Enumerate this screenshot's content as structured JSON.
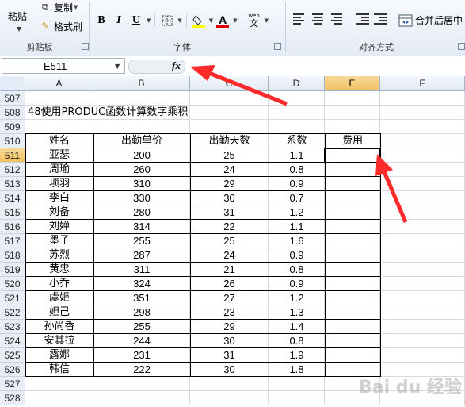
{
  "ribbon": {
    "paste_label": "粘贴",
    "copy_label": "复制",
    "format_painter_label": "格式刷",
    "clipboard_group": "剪贴板",
    "font_group": "字体",
    "align_group": "对齐方式",
    "bold": "B",
    "italic": "I",
    "underline": "U",
    "font_color_letter": "A",
    "merge_label": "合并后居中",
    "wen_label": "wén",
    "wen_char": "文"
  },
  "formula_bar": {
    "name_box": "E511",
    "fx": "fx",
    "formula": ""
  },
  "columns": [
    "A",
    "B",
    "C",
    "D",
    "E",
    "F"
  ],
  "rows": [
    "507",
    "508",
    "509",
    "510",
    "511",
    "512",
    "513",
    "514",
    "515",
    "516",
    "517",
    "518",
    "519",
    "520",
    "521",
    "522",
    "523",
    "524",
    "525",
    "526",
    "527",
    "528"
  ],
  "title": "48使用PRODUC函数计算数字乘积",
  "table": {
    "headers": [
      "姓名",
      "出勤单价",
      "出勤天数",
      "系数",
      "费用"
    ],
    "records": [
      [
        "亚瑟",
        "200",
        "25",
        "1.1",
        ""
      ],
      [
        "周瑜",
        "260",
        "24",
        "0.8",
        ""
      ],
      [
        "项羽",
        "310",
        "29",
        "0.9",
        ""
      ],
      [
        "李白",
        "330",
        "30",
        "0.7",
        ""
      ],
      [
        "刘备",
        "280",
        "31",
        "1.2",
        ""
      ],
      [
        "刘婵",
        "314",
        "22",
        "1.1",
        ""
      ],
      [
        "墨子",
        "255",
        "25",
        "1.6",
        ""
      ],
      [
        "苏烈",
        "287",
        "24",
        "0.9",
        ""
      ],
      [
        "黄忠",
        "311",
        "21",
        "0.8",
        ""
      ],
      [
        "小乔",
        "324",
        "26",
        "0.9",
        ""
      ],
      [
        "虞姬",
        "351",
        "27",
        "1.2",
        ""
      ],
      [
        "妲己",
        "298",
        "23",
        "1.3",
        ""
      ],
      [
        "孙尚香",
        "255",
        "29",
        "1.4",
        ""
      ],
      [
        "安其拉",
        "244",
        "30",
        "0.8",
        ""
      ],
      [
        "露娜",
        "231",
        "31",
        "1.9",
        ""
      ],
      [
        "韩信",
        "222",
        "30",
        "1.8",
        ""
      ]
    ]
  },
  "active_cell": "E511",
  "watermark": "Bai du 经验"
}
